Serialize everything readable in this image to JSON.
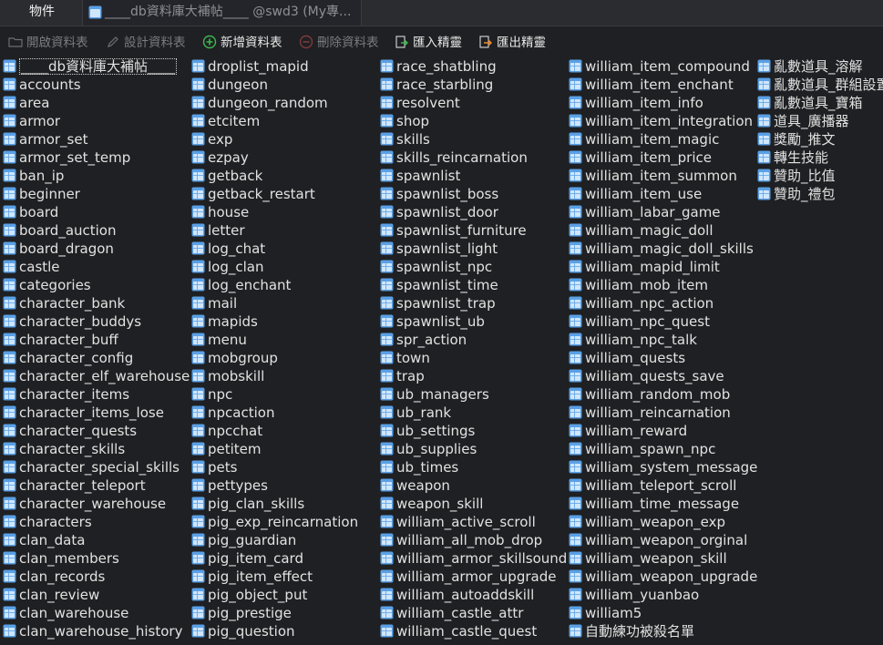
{
  "tabs": [
    {
      "label": "物件"
    },
    {
      "label": "____db資料庫大補帖____ @swd3 (My專..."
    }
  ],
  "toolbar": {
    "open_table": "開啟資料表",
    "design_table": "設計資料表",
    "new_table": "新增資料表",
    "delete_table": "刪除資料表",
    "import_wizard": "匯入精靈",
    "export_wizard": "匯出精靈"
  },
  "colors": {
    "table_icon": "#5aa0e6",
    "new_icon": "#3fb650",
    "background": "#1f2023"
  },
  "columns": [
    [
      "____db資料庫大補帖____",
      "accounts",
      "area",
      "armor",
      "armor_set",
      "armor_set_temp",
      "ban_ip",
      "beginner",
      "board",
      "board_auction",
      "board_dragon",
      "castle",
      "categories",
      "character_bank",
      "character_buddys",
      "character_buff",
      "character_config",
      "character_elf_warehouse",
      "character_items",
      "character_items_lose",
      "character_quests",
      "character_skills",
      "character_special_skills",
      "character_teleport",
      "character_warehouse",
      "characters",
      "clan_data",
      "clan_members",
      "clan_records",
      "clan_review",
      "clan_warehouse",
      "clan_warehouse_history"
    ],
    [
      "droplist_mapid",
      "dungeon",
      "dungeon_random",
      "etcitem",
      "exp",
      "ezpay",
      "getback",
      "getback_restart",
      "house",
      "letter",
      "log_chat",
      "log_clan",
      "log_enchant",
      "mail",
      "mapids",
      "menu",
      "mobgroup",
      "mobskill",
      "npc",
      "npcaction",
      "npcchat",
      "petitem",
      "pets",
      "pettypes",
      "pig_clan_skills",
      "pig_exp_reincarnation",
      "pig_guardian",
      "pig_item_card",
      "pig_item_effect",
      "pig_object_put",
      "pig_prestige",
      "pig_question"
    ],
    [
      "race_shatbling",
      "race_starbling",
      "resolvent",
      "shop",
      "skills",
      "skills_reincarnation",
      "spawnlist",
      "spawnlist_boss",
      "spawnlist_door",
      "spawnlist_furniture",
      "spawnlist_light",
      "spawnlist_npc",
      "spawnlist_time",
      "spawnlist_trap",
      "spawnlist_ub",
      "spr_action",
      "town",
      "trap",
      "ub_managers",
      "ub_rank",
      "ub_settings",
      "ub_supplies",
      "ub_times",
      "weapon",
      "weapon_skill",
      "william_active_scroll",
      "william_all_mob_drop",
      "william_armor_skillsound",
      "william_armor_upgrade",
      "william_autoaddskill",
      "william_castle_attr",
      "william_castle_quest"
    ],
    [
      "william_item_compound",
      "william_item_enchant",
      "william_item_info",
      "william_item_integration",
      "william_item_magic",
      "william_item_price",
      "william_item_summon",
      "william_item_use",
      "william_labar_game",
      "william_magic_doll",
      "william_magic_doll_skills",
      "william_mapid_limit",
      "william_mob_item",
      "william_npc_action",
      "william_npc_quest",
      "william_npc_talk",
      "william_quests",
      "william_quests_save",
      "william_random_mob",
      "william_reincarnation",
      "william_reward",
      "william_spawn_npc",
      "william_system_message",
      "william_teleport_scroll",
      "william_time_message",
      "william_weapon_exp",
      "william_weapon_orginal",
      "william_weapon_skill",
      "william_weapon_upgrade",
      "william_yuanbao",
      "william5",
      "自動練功被殺名單"
    ],
    [
      "亂數道具_溶解",
      "亂數道具_群組設置",
      "亂數道具_寶箱",
      "道具_廣播器",
      "獎勵_推文",
      "轉生技能",
      "贊助_比值",
      "贊助_禮包"
    ]
  ]
}
